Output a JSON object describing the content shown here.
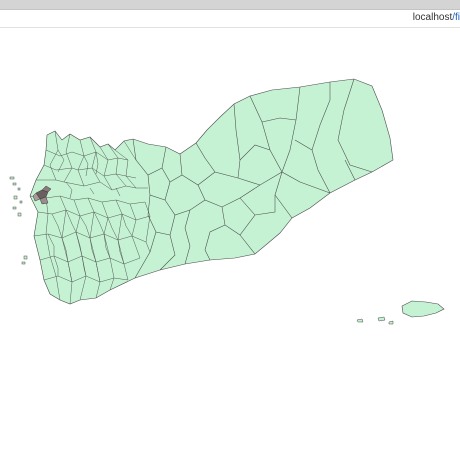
{
  "browser": {
    "address_host": "localhost",
    "address_rest": "/fi"
  },
  "map": {
    "land_fill": "#c4f2d2",
    "border_color": "#4a4a4a",
    "background": "#ffffff"
  }
}
